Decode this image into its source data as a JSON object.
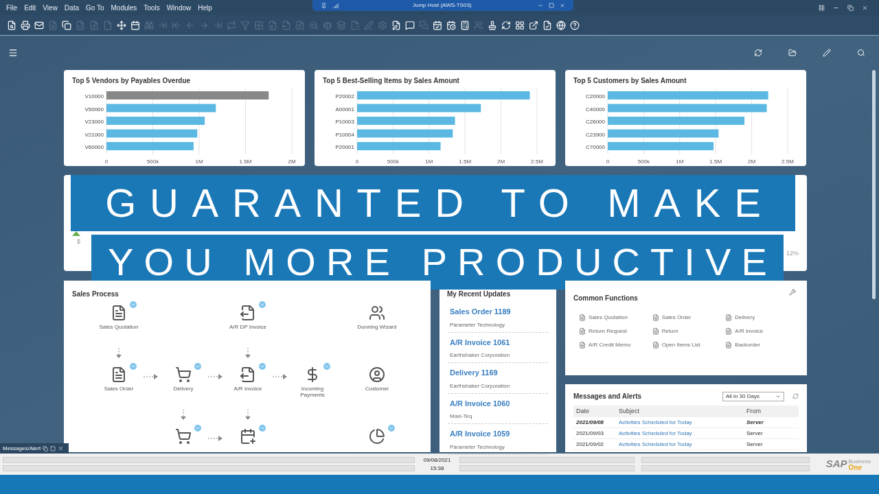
{
  "menu": [
    {
      "label": "File"
    },
    {
      "label": "Edit"
    },
    {
      "label": "View"
    },
    {
      "label": "Data"
    },
    {
      "label": "Go To"
    },
    {
      "label": "Modules"
    },
    {
      "label": "Tools"
    },
    {
      "label": "Window"
    },
    {
      "label": "Help"
    }
  ],
  "remote_bar": {
    "title": "Jump Host (AWS-TS03)"
  },
  "toolbar": [
    {
      "disabled": false
    },
    {
      "disabled": false
    },
    {
      "disabled": false
    },
    {
      "disabled": true
    },
    {
      "disabled": false
    },
    {
      "disabled": true
    },
    {
      "disabled": true
    },
    {
      "disabled": true
    },
    {
      "disabled": false
    },
    {
      "disabled": false
    },
    {
      "disabled": true
    },
    {
      "disabled": true
    },
    {
      "disabled": true
    },
    {
      "disabled": true
    },
    {
      "disabled": true
    },
    {
      "disabled": true
    },
    {
      "disabled": true
    },
    {
      "disabled": true
    },
    {
      "disabled": true
    },
    {
      "disabled": true
    },
    {
      "disabled": true
    },
    {
      "disabled": true
    },
    {
      "disabled": true
    },
    {
      "disabled": true
    },
    {
      "disabled": true
    },
    {
      "disabled": true
    },
    {
      "disabled": true
    },
    {
      "disabled": true
    },
    {
      "disabled": false
    },
    {
      "disabled": false
    },
    {
      "disabled": true
    },
    {
      "disabled": false
    },
    {
      "disabled": false
    },
    {
      "disabled": false
    },
    {
      "disabled": true
    },
    {
      "disabled": false
    },
    {
      "disabled": false
    },
    {
      "disabled": false
    },
    {
      "disabled": false
    },
    {
      "disabled": false
    },
    {
      "disabled": false
    },
    {
      "disabled": false
    }
  ],
  "charts": [
    {
      "title": "Top 5 Vendors by Payables Overdue",
      "chart_data": {
        "type": "bar",
        "orientation": "horizontal",
        "grid": true,
        "categories": [
          "V10000",
          "V50000",
          "V23000",
          "V21000",
          "V60000"
        ],
        "series": [
          {
            "color": "#888888",
            "values": [
              1750000,
              null,
              null,
              null,
              null
            ]
          },
          {
            "color": "#5bb8e3",
            "values": [
              null,
              1180000,
              1060000,
              980000,
              940000
            ]
          }
        ],
        "xlim": [
          0,
          2000000
        ],
        "xticks": [
          {
            "value": 0,
            "label": "0"
          },
          {
            "value": 500000,
            "label": "500k"
          },
          {
            "value": 1000000,
            "label": "1M"
          },
          {
            "value": 1500000,
            "label": "1.5M"
          },
          {
            "value": 2000000,
            "label": "2M"
          }
        ]
      }
    },
    {
      "title": "Top 5 Best-Selling Items by Sales Amount",
      "chart_data": {
        "type": "bar",
        "orientation": "horizontal",
        "grid": true,
        "categories": [
          "P20002",
          "A00001",
          "P10003",
          "P10004",
          "P20001"
        ],
        "series": [
          {
            "color": "#5bb8e3",
            "values": [
              2400000,
              1720000,
              1360000,
              1330000,
              1160000
            ]
          }
        ],
        "xlim": [
          0,
          2500000
        ],
        "xticks": [
          {
            "value": 0,
            "label": "0"
          },
          {
            "value": 500000,
            "label": "500k"
          },
          {
            "value": 1000000,
            "label": "1M"
          },
          {
            "value": 1500000,
            "label": "1.5M"
          },
          {
            "value": 2000000,
            "label": "2M"
          },
          {
            "value": 2500000,
            "label": "2.5M"
          }
        ]
      }
    },
    {
      "title": "Top 5 Customers by Sales Amount",
      "chart_data": {
        "type": "bar",
        "orientation": "horizontal",
        "grid": true,
        "categories": [
          "C20000",
          "C40000",
          "C26000",
          "C23900",
          "C70000"
        ],
        "series": [
          {
            "color": "#5bb8e3",
            "values": [
              2230000,
              2210000,
              1900000,
              1540000,
              1470000
            ]
          }
        ],
        "xlim": [
          0,
          2500000
        ],
        "xticks": [
          {
            "value": 0,
            "label": "0"
          },
          {
            "value": 500000,
            "label": "500k"
          },
          {
            "value": 1000000,
            "label": "1M"
          },
          {
            "value": 1500000,
            "label": "1.5M"
          },
          {
            "value": 2000000,
            "label": "2M"
          },
          {
            "value": 2500000,
            "label": "2.5M"
          }
        ]
      }
    }
  ],
  "kpi": {
    "currency": "$",
    "percent": "12%"
  },
  "banner": {
    "lines": [
      "GUARANTED TO MAKE",
      "YOU MORE PRODUCTIVE"
    ]
  },
  "sales_process": {
    "title": "Sales Process",
    "nodes": [
      {
        "label": "Sales Quotation",
        "badge": true
      },
      {
        "label": "A/R DP Invoice",
        "badge": true
      },
      {
        "label": "Dunning Wizard",
        "badge": false
      },
      {
        "label": "Sales Order",
        "badge": true
      },
      {
        "label": "Delivery",
        "badge": true
      },
      {
        "label": "A/R Invoice",
        "badge": true
      },
      {
        "label": "Incoming Payments",
        "badge": true
      },
      {
        "label": "Customer",
        "badge": false
      },
      {
        "badge": true
      },
      {
        "badge": true
      },
      {
        "badge": true
      }
    ]
  },
  "recent_updates": {
    "title": "My Recent Updates",
    "items": [
      {
        "title": "Sales Order 1189",
        "subtitle": "Parameter Technology"
      },
      {
        "title": "A/R Invoice 1061",
        "subtitle": "Earthshaker Corporation"
      },
      {
        "title": "Delivery 1169",
        "subtitle": "Earthshaker Corporation"
      },
      {
        "title": "A/R Invoice 1060",
        "subtitle": "Maxi-Teq"
      },
      {
        "title": "A/R Invoice 1059",
        "subtitle": "Parameter Technology"
      }
    ]
  },
  "common_functions": {
    "title": "Common Functions",
    "items": [
      {
        "label": "Sales Quotation"
      },
      {
        "label": "Sales Order"
      },
      {
        "label": "Delivery"
      },
      {
        "label": "Return Request"
      },
      {
        "label": "Return"
      },
      {
        "label": "A/R Invoice"
      },
      {
        "label": "A/R Credit Memo"
      },
      {
        "label": "Open Items List"
      },
      {
        "label": "Backorder"
      }
    ]
  },
  "messages": {
    "title": "Messages and Alerts",
    "filter": "All in 30 Days",
    "columns": [
      "Date",
      "Subject",
      "From"
    ],
    "rows": [
      {
        "date": "2021/09/08",
        "subject": "Activities Scheduled for Today",
        "from": "Server",
        "unread": true
      },
      {
        "date": "2021/09/03",
        "subject": "Activities Scheduled for Today",
        "from": "Server",
        "unread": false
      },
      {
        "date": "2021/09/02",
        "subject": "Activities Scheduled for Today",
        "from": "Server",
        "unread": false
      }
    ]
  },
  "mini_window": {
    "title": "Messages/Alert"
  },
  "status_bar": {
    "date": "09/08/2021",
    "time": "15:38"
  },
  "logo": {
    "brand": "SAP",
    "line1": "Business",
    "line2": "One"
  }
}
